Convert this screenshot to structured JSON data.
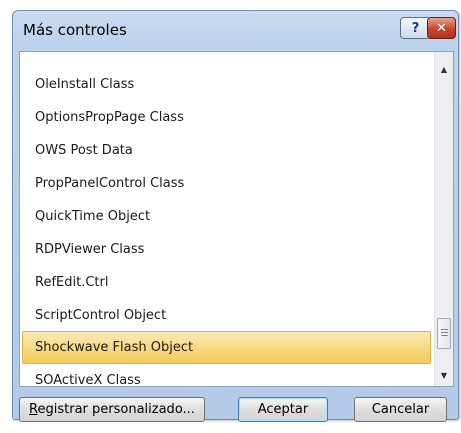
{
  "dialog": {
    "title": "Más controles",
    "help_glyph": "?",
    "close_glyph": "✕"
  },
  "list": {
    "items": [
      {
        "label": "OleInstall Class",
        "selected": false
      },
      {
        "label": "OptionsPropPage Class",
        "selected": false
      },
      {
        "label": "OWS Post Data",
        "selected": false
      },
      {
        "label": "PropPanelControl Class",
        "selected": false
      },
      {
        "label": "QuickTime Object",
        "selected": false
      },
      {
        "label": "RDPViewer Class",
        "selected": false
      },
      {
        "label": "RefEdit.Ctrl",
        "selected": false
      },
      {
        "label": "ScriptControl Object",
        "selected": false
      },
      {
        "label": "Shockwave Flash Object",
        "selected": true
      },
      {
        "label": "SOActiveX Class",
        "selected": false
      }
    ],
    "selection_color": "#f7d77a"
  },
  "buttons": {
    "register_prefix": "",
    "register_accel": "R",
    "register_rest": "egistrar personalizado...",
    "accept": "Aceptar",
    "cancel": "Cancelar"
  },
  "icons": {
    "scroll_up": "triangle-up-icon",
    "scroll_down": "triangle-down-icon",
    "scroll_thumb": "grip-icon"
  }
}
